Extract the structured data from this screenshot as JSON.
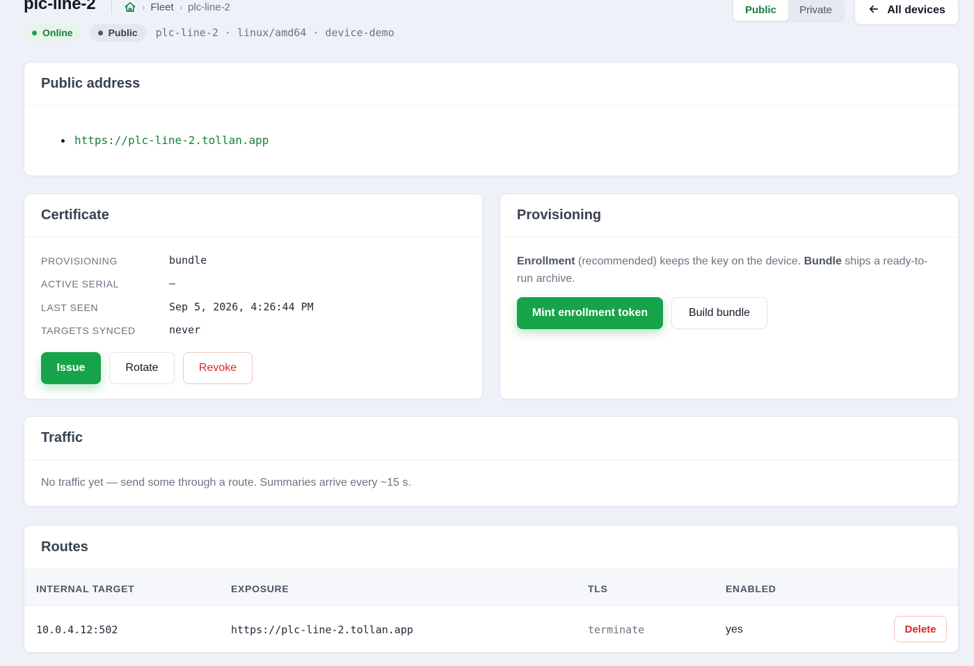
{
  "header": {
    "title": "plc-line-2",
    "breadcrumb": {
      "fleet": "Fleet",
      "current": "plc-line-2"
    },
    "status_online": "Online",
    "status_public": "Public",
    "meta": "plc-line-2 · linux/amd64 · device-demo",
    "visibility_toggle": {
      "public": "Public",
      "private": "Private",
      "selected": "Public"
    },
    "all_devices_label": "All devices"
  },
  "public_address": {
    "title": "Public address",
    "urls": [
      "https://plc-line-2.tollan.app"
    ]
  },
  "certificate": {
    "title": "Certificate",
    "fields": [
      {
        "key": "PROVISIONING",
        "value": "bundle"
      },
      {
        "key": "ACTIVE SERIAL",
        "value": "—"
      },
      {
        "key": "LAST SEEN",
        "value": "Sep 5, 2026, 4:26:44 PM"
      },
      {
        "key": "TARGETS SYNCED",
        "value": "never"
      }
    ],
    "buttons": {
      "issue": "Issue",
      "rotate": "Rotate",
      "revoke": "Revoke"
    }
  },
  "provisioning": {
    "title": "Provisioning",
    "enrollment_word": "Enrollment",
    "text_1": " (recommended) keeps the key on the device. ",
    "bundle_word": "Bundle",
    "text_2": " ships a ready-to-run archive.",
    "buttons": {
      "mint": "Mint enrollment token",
      "build": "Build bundle"
    }
  },
  "traffic": {
    "title": "Traffic",
    "message": "No traffic yet — send some through a route. Summaries arrive every ~15 s."
  },
  "routes": {
    "title": "Routes",
    "columns": [
      "INTERNAL TARGET",
      "EXPOSURE",
      "TLS",
      "ENABLED"
    ],
    "rows": [
      {
        "target": "10.0.4.12:502",
        "exposure": "https://plc-line-2.tollan.app",
        "tls": "terminate",
        "enabled": "yes",
        "action": "Delete"
      }
    ]
  },
  "colors": {
    "accent": "#16a34a",
    "danger": "#dc2626",
    "background": "#eef1f8"
  }
}
